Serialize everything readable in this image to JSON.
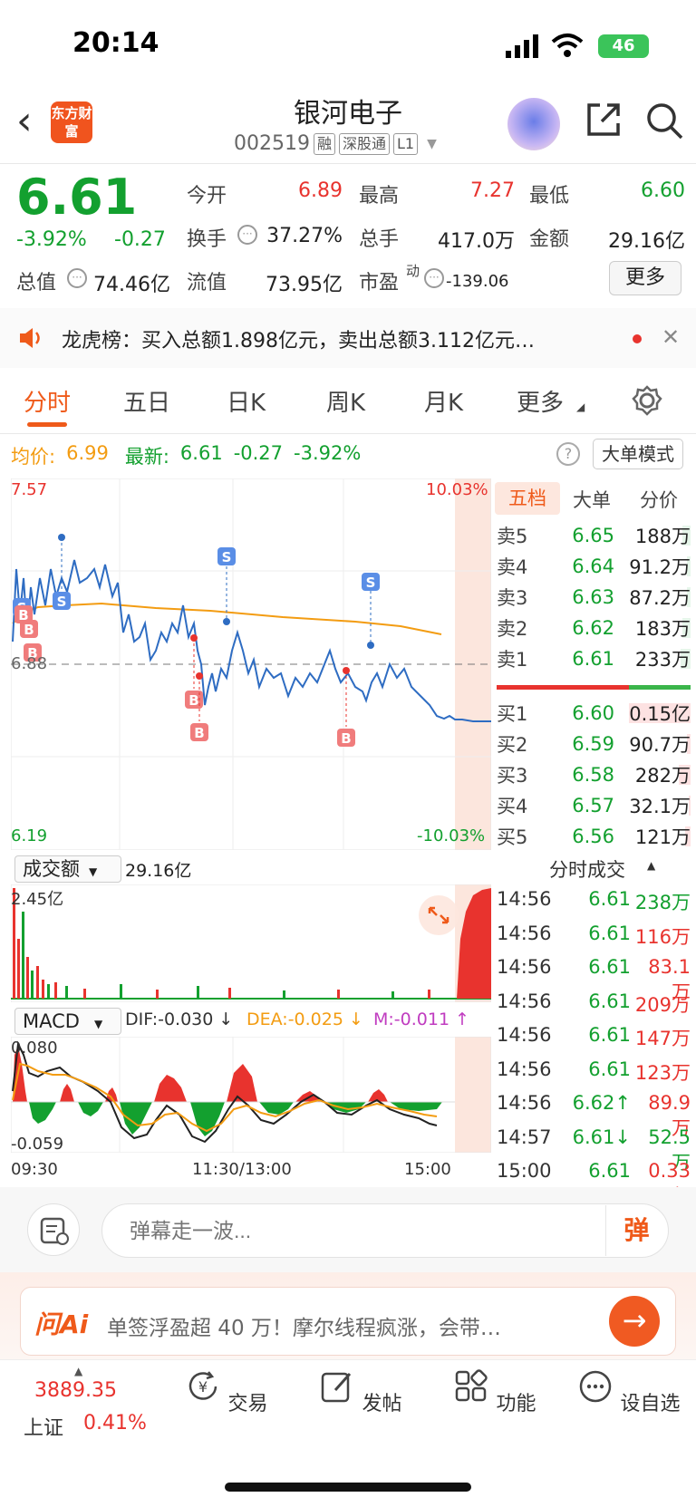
{
  "status": {
    "time": "20:14",
    "battery": "46"
  },
  "header": {
    "logo": "东方财富",
    "name": "银河电子",
    "code": "002519",
    "tags": [
      "融",
      "深股通",
      "L1"
    ]
  },
  "quote": {
    "price": "6.61",
    "change_pct": "-3.92%",
    "change_amt": "-0.27",
    "open_label": "今开",
    "open": "6.89",
    "high_label": "最高",
    "high": "7.27",
    "low_label": "最低",
    "low": "6.60",
    "turnover_label": "换手",
    "turnover": "37.27%",
    "volume_label": "总手",
    "volume": "417.0万",
    "amount_label": "金额",
    "amount": "29.16亿",
    "mktcap_label": "总值",
    "mktcap": "74.46亿",
    "float_label": "流值",
    "float": "73.95亿",
    "pe_label": "市盈",
    "pe_sup": "动",
    "pe": "-139.06",
    "more_label": "更多"
  },
  "news": {
    "text": "龙虎榜：买入总额1.898亿元，卖出总额3.112亿元…"
  },
  "tabs": [
    "分时",
    "五日",
    "日K",
    "周K",
    "月K",
    "更多"
  ],
  "avg_row": {
    "avg_label": "均价:",
    "avg": "6.99",
    "latest_label": "最新:",
    "latest": "6.61",
    "latest_chg": "-0.27",
    "latest_pct": "-3.92%",
    "mode_btn": "大单模式"
  },
  "chart_labels": {
    "ymax": "7.57",
    "ymin": "6.19",
    "pmax": "10.03%",
    "pmin": "-10.03%",
    "ref": "6.88",
    "x_start": "09:30",
    "x_mid": "11:30/13:00",
    "x_end": "15:00",
    "vol_tag": "成交额",
    "vol_total": "29.16亿",
    "vol_max": "2.45亿",
    "macd_tag": "MACD",
    "dif": "DIF:-0.030 ↓",
    "dea": "DEA:-0.025 ↓",
    "m": "M:-0.011 ↑",
    "macd_max": "0.080",
    "macd_min": "-0.059"
  },
  "order_book": {
    "tabs": [
      "五档",
      "大单",
      "分价"
    ],
    "sells": [
      {
        "label": "卖5",
        "price": "6.65",
        "vol": "188万",
        "ratio": 0.04
      },
      {
        "label": "卖4",
        "price": "6.64",
        "vol": "91.2万",
        "ratio": 0.02
      },
      {
        "label": "卖3",
        "price": "6.63",
        "vol": "87.2万",
        "ratio": 0.02
      },
      {
        "label": "卖2",
        "price": "6.62",
        "vol": "183万",
        "ratio": 0.04
      },
      {
        "label": "卖1",
        "price": "6.61",
        "vol": "233万",
        "ratio": 0.05
      }
    ],
    "buys": [
      {
        "label": "买1",
        "price": "6.60",
        "vol": "0.15亿",
        "ratio": 0.32
      },
      {
        "label": "买2",
        "price": "6.59",
        "vol": "90.7万",
        "ratio": 0.02
      },
      {
        "label": "买3",
        "price": "6.58",
        "vol": "282万",
        "ratio": 0.06
      },
      {
        "label": "买4",
        "price": "6.57",
        "vol": "32.1万",
        "ratio": 0.01
      },
      {
        "label": "买5",
        "price": "6.56",
        "vol": "121万",
        "ratio": 0.03
      }
    ]
  },
  "ticks": {
    "title": "分时成交",
    "rows": [
      {
        "t": "14:56",
        "p": "6.61",
        "v": "238万",
        "c": "green"
      },
      {
        "t": "14:56",
        "p": "6.61",
        "v": "116万",
        "c": "red"
      },
      {
        "t": "14:56",
        "p": "6.61",
        "v": "83.1万",
        "c": "red"
      },
      {
        "t": "14:56",
        "p": "6.61",
        "v": "209万",
        "c": "red"
      },
      {
        "t": "14:56",
        "p": "6.61",
        "v": "147万",
        "c": "red"
      },
      {
        "t": "14:56",
        "p": "6.61",
        "v": "123万",
        "c": "red"
      },
      {
        "t": "14:56",
        "p": "6.62↑",
        "v": "89.9万",
        "c": "red"
      },
      {
        "t": "14:57",
        "p": "6.61↓",
        "v": "52.5万",
        "c": "green"
      },
      {
        "t": "15:00",
        "p": "6.61",
        "v": "0.33亿",
        "c": "red"
      }
    ]
  },
  "danmu": {
    "placeholder": "弹幕走一波...",
    "send": "弹"
  },
  "ai": {
    "logo": "问Ai",
    "text": "单签浮盈超 40 万！摩尔线程疯涨，会带…"
  },
  "nav": {
    "index_value": "3889.35",
    "index_name": "上证",
    "index_pct": "0.41%",
    "items": [
      "交易",
      "发帖",
      "功能",
      "设自选"
    ]
  },
  "colors": {
    "up": "#e8332e",
    "down": "#13a02f",
    "accent": "#ef5a1a",
    "avg_line": "#f39c12",
    "price_line": "#2e6cc2"
  }
}
